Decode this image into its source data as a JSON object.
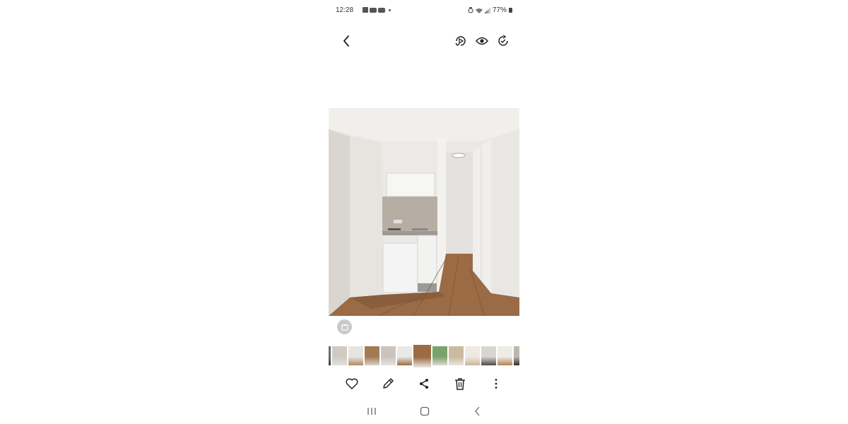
{
  "status_bar": {
    "time": "12:28",
    "battery": "77%",
    "left_icons": [
      "gallery-notification-icon",
      "youtube-icon",
      "youtube-icon",
      "more-dot-icon"
    ],
    "right_icons": [
      "alarm-icon",
      "wifi-icon",
      "signal-icon",
      "battery-icon"
    ]
  },
  "top_toolbar": {
    "back": "back-icon",
    "actions": [
      "remaster-icon",
      "view-icon",
      "rotate-icon"
    ]
  },
  "photo": {
    "subject": "kitchenette-room-photo"
  },
  "thumbnails": {
    "count": 13,
    "active_index": 6
  },
  "bottom_toolbar": {
    "actions": [
      "favorite-icon",
      "edit-icon",
      "share-icon",
      "delete-icon",
      "more-options-icon"
    ]
  },
  "nav_bar": {
    "buttons": [
      "recents-icon",
      "home-icon",
      "back-nav-icon"
    ]
  },
  "colors": {
    "icon": "#333333",
    "background": "#ffffff",
    "floor": "#9a6b45",
    "wall": "#e8e6e2"
  }
}
